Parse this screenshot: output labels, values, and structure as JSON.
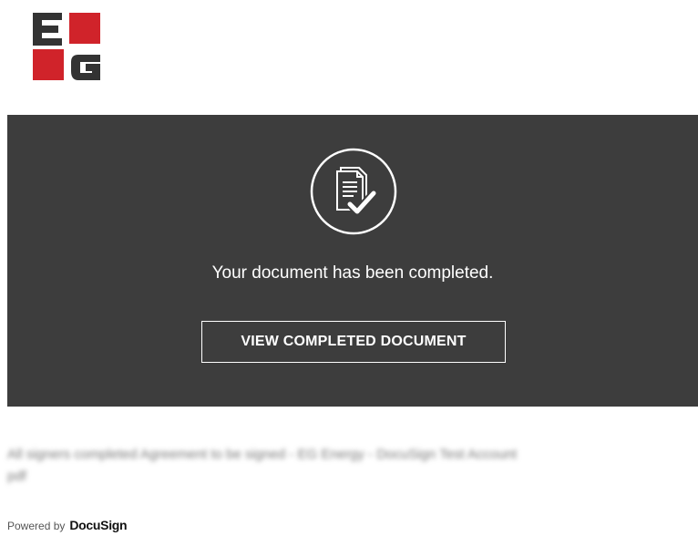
{
  "logo": {
    "text": "EG",
    "colors": {
      "red": "#d0232a",
      "dark": "#333333"
    }
  },
  "banner": {
    "background": "#3d3d3d",
    "icon": "document-check-icon",
    "message": "Your document has been completed.",
    "button_label": "VIEW COMPLETED DOCUMENT"
  },
  "footer": {
    "blurred_line_1": "All signers completed Agreement to be signed - EG Energy - DocuSign Test Account",
    "blurred_line_2": "pdf",
    "powered_by_prefix": "Powered by",
    "powered_by_brand": "DocuSign"
  }
}
